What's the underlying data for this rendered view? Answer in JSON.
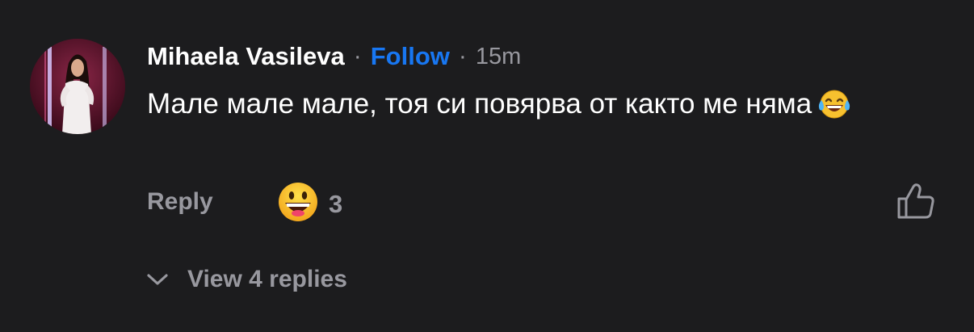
{
  "comment": {
    "author": "Mihaela Vasileva",
    "separator": "·",
    "follow_label": "Follow",
    "timestamp": "15m",
    "text": "Мале мале мале, тоя си повярва от както ме няма",
    "text_emoji": "tears-of-joy-emoji",
    "reply_label": "Reply",
    "reaction": {
      "icon": "grinning-face-emoji",
      "count": "3"
    },
    "like_icon": "thumbs-up-icon",
    "view_replies_label": "View 4 replies",
    "view_replies_icon": "chevron-down-icon"
  },
  "colors": {
    "background": "#1c1c1e",
    "primary_text": "#ffffff",
    "secondary_text": "#98989f",
    "accent": "#1877f2"
  }
}
